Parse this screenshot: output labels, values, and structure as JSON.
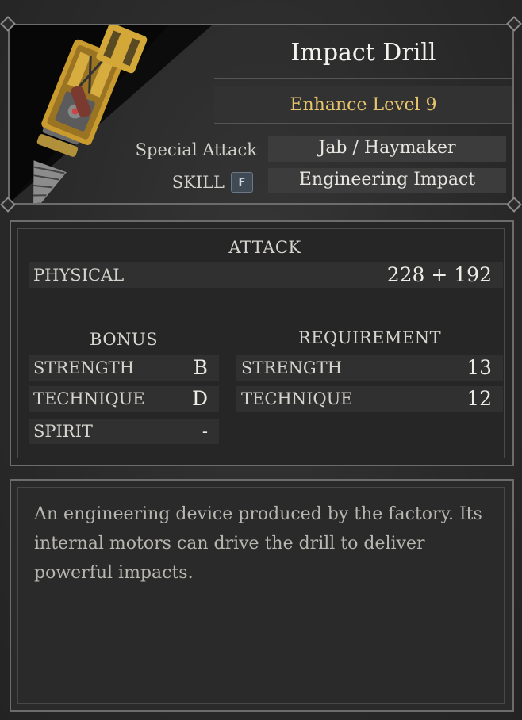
{
  "item": {
    "name": "Impact Drill",
    "enhance": "Enhance Level 9",
    "icon": "impact-drill-icon",
    "special_attack_label": "Special Attack",
    "special_attack_value": "Jab / Haymaker",
    "skill_label": "SKILL",
    "skill_key": "F",
    "skill_value": "Engineering Impact"
  },
  "attack": {
    "title": "ATTACK",
    "physical_label": "PHYSICAL",
    "physical_value": "228 + 192"
  },
  "bonus": {
    "title": "BONUS",
    "rows": [
      {
        "label": "STRENGTH",
        "value": "B"
      },
      {
        "label": "TECHNIQUE",
        "value": "D"
      },
      {
        "label": "SPIRIT",
        "value": "-"
      }
    ]
  },
  "requirement": {
    "title": "REQUIREMENT",
    "rows": [
      {
        "label": "STRENGTH",
        "value": "13"
      },
      {
        "label": "TECHNIQUE",
        "value": "12"
      }
    ]
  },
  "description": "An engineering device produced by the factory. Its internal motors can drive the drill to deliver powerful impacts.",
  "colors": {
    "enhance": "#e8c56d",
    "frame": "#6c6c6c",
    "key_badge": "#3f4a55"
  }
}
